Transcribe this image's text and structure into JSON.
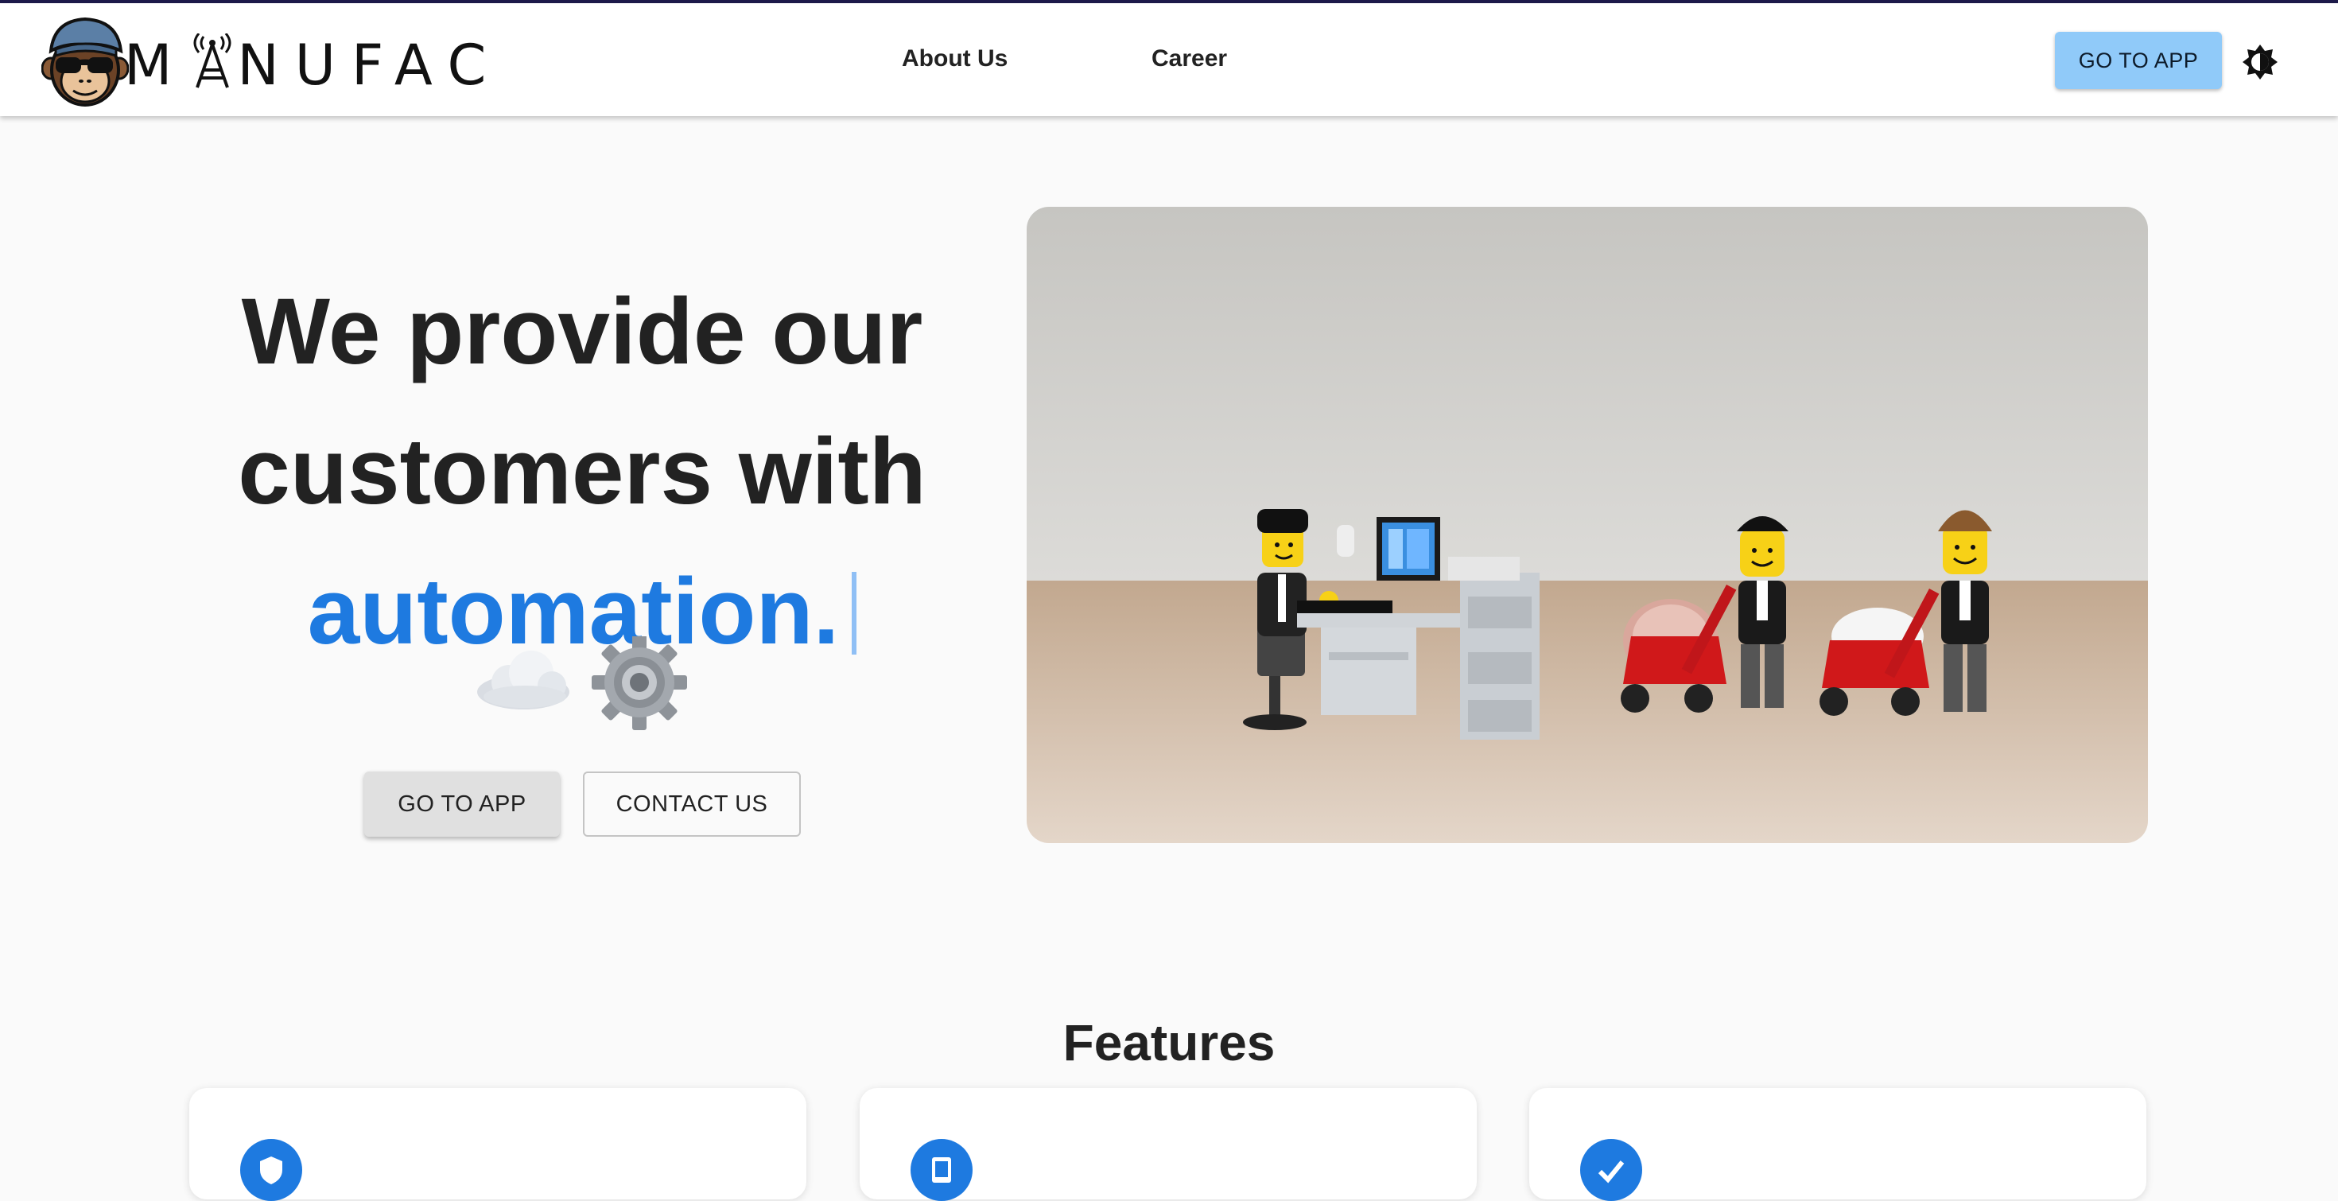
{
  "header": {
    "brand": "MANUFAC",
    "nav": [
      {
        "label": "About Us"
      },
      {
        "label": "Career"
      }
    ],
    "go_to_app": "GO TO APP",
    "theme_toggle_icon": "brightness-icon"
  },
  "hero": {
    "title_line1": "We provide our",
    "title_line2": "customers with",
    "title_accent": "automation.",
    "emojis": [
      "cloud-icon",
      "gear-icon"
    ],
    "go_to_app": "GO TO APP",
    "contact_us": "CONTACT US",
    "image": "lego-office-workers-illustration"
  },
  "features": {
    "title": "Features",
    "cards": [
      {
        "icon": "shield-icon"
      },
      {
        "icon": "tablet-icon"
      },
      {
        "icon": "check-icon"
      }
    ]
  },
  "colors": {
    "accent": "#1e7ae0",
    "header_button": "#90caf9",
    "background": "#fafafa",
    "top_bar": "#1e1b4b"
  }
}
